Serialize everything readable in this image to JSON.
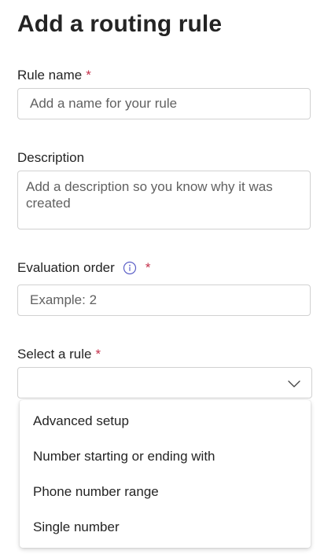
{
  "page": {
    "title": "Add a routing rule"
  },
  "rule_name": {
    "label": "Rule name",
    "required_marker": "*",
    "placeholder": "Add a name for your rule",
    "value": ""
  },
  "description": {
    "label": "Description",
    "placeholder": "Add a description so you know why it was created",
    "value": ""
  },
  "evaluation_order": {
    "label": "Evaluation order",
    "required_marker": "*",
    "info_icon": "info-icon",
    "placeholder": "Example: 2",
    "value": ""
  },
  "select_rule": {
    "label": "Select a rule",
    "required_marker": "*",
    "selected": "",
    "chevron_icon": "chevron-down-icon",
    "options": [
      "Advanced setup",
      "Number starting or ending with",
      "Phone number range",
      "Single number"
    ]
  },
  "colors": {
    "required": "#c4314b",
    "info_icon": "#5b5fc7",
    "border": "#d1d1d1",
    "text": "#242424",
    "placeholder": "#616161"
  }
}
